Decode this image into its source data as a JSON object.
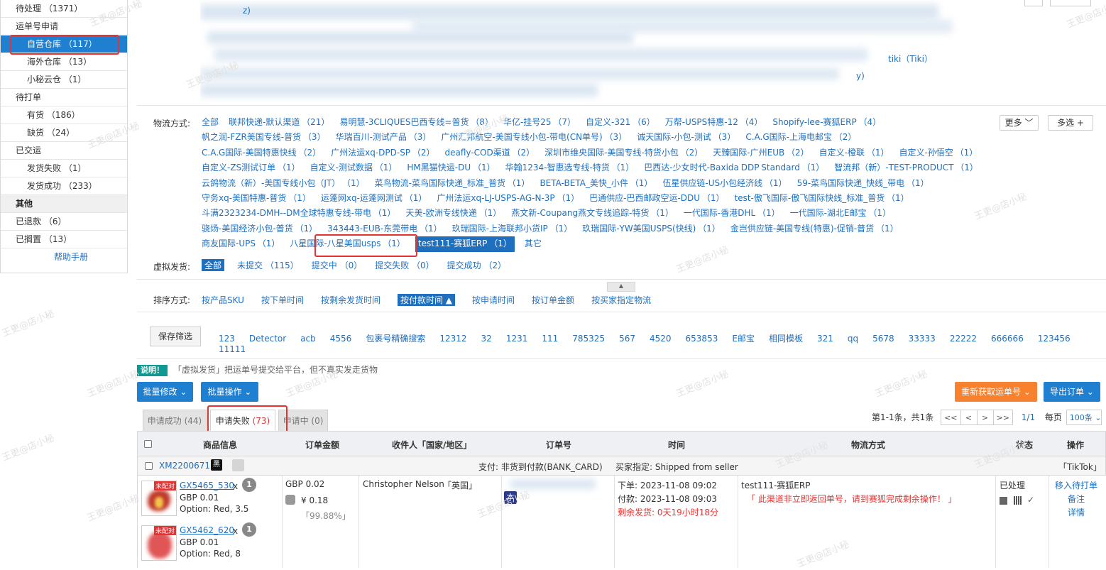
{
  "sidebar": {
    "top_item": "待处理 （1371）",
    "groups": [
      {
        "label": "运单号申请"
      },
      {
        "label": "待打单"
      },
      {
        "label": "已交运"
      }
    ],
    "items": [
      "自营仓库 （117）",
      "海外仓库 （13）",
      "小秘云仓 （1）",
      "有货 （186）",
      "缺货 （24）",
      "发货失败 （1）",
      "发货成功 （233）"
    ],
    "other_title": "其他",
    "other_items": [
      "已退款 （6）",
      "已搁置 （13）"
    ],
    "help": "帮助手册"
  },
  "platform": {
    "tiki": "tiki（Tiki）",
    "partial_y": "y)",
    "partial_z": "z)"
  },
  "filter": {
    "logistics_label": "物流方式:",
    "logistics_options": [
      "全部",
      "联邦快递-默认渠道 （21）",
      "易明慧-3CLIQUES巴西专线=普货 （8）",
      "华亿-挂号25 （7）",
      "自定义-321 （6）",
      "万帮-USPS特惠-12 （4）",
      "Shopify-lee-赛狐ERP （4）",
      "帆之润-FZR美国专线-普货 （3）",
      "华瑞百川-测试产品 （3）",
      "广州汇邦航空-美国专线小包-带电(CN单号) （3）",
      "诚天国际-小包-测试 （3）",
      "C.A.G国际-上海电邮宝 （2）",
      "C.A.G国际-美国特惠快线 （2）",
      "广州法运xq-DPD-SP （2）",
      "deafly-COD渠道 （2）",
      "深圳市维央国际-美国专线-特货小包 （2）",
      "天臻国际-广州EUB （2）",
      "自定义-橙联 （1）",
      "自定义-孙悟空 （1）",
      "自定义-ZS测试订单 （1）",
      "自定义-测试数据 （1）",
      "HM黑猫快运-DU （1）",
      "华翰1234-智惠选专线-特货 （1）",
      "巴西达-少女时代-Baxida DDP Standard （1）",
      "智流邦（新）-TEST-PRODUCT （1）",
      "云鸽物流（新）-美国专线小包（JT） （1）",
      "菜鸟物流-菜鸟国际快递_标准_普货 （1）",
      "BETA-BETA_美快_小件 （1）",
      "伍星供应链-US小包经济线 （1）",
      "59-菜鸟国际快递_快线_带电 （1）",
      "守务xq-美国特惠-普货 （1）",
      "运蓬网xq-运蓬网测试 （1）",
      "广州法运xq-LJ-USPS-AG-N-3P （1）",
      "巴通供应-巴西邮政空运-DDU （1）",
      "test-傲飞国际-傲飞国际快线_标准_普货 （1）",
      "斗满2323234-DMH--DM全球特惠专线-带电 （1）",
      "天美-欧洲专线快递 （1）",
      "燕文新-Coupang燕文专线追踪-特货 （1）",
      "一代国际-香港DHL （1）",
      "一代国际-湖北E邮宝 （1）",
      "骁炀-美国经济小包-普货 （1）",
      "343443-EUB-东莞带电 （1）",
      "玖瑞国际-上海联邦小货IP （1）",
      "玖瑞国际-YW美国USPS(快线) （1）",
      "金岂供应链-美国专线(特惠)-促销-普货 （1）",
      "商友国际-UPS （1）",
      "八星国际-八星美国usps （1）",
      "test111-赛狐ERP （1）",
      "其它"
    ],
    "more_btn": "更多",
    "multi_btn": "多选 +",
    "virtual_label": "虚拟发货:",
    "virtual_options": [
      "全部",
      "未提交 （115）",
      "提交中 （0）",
      "提交失败 （0）",
      "提交成功 （2）"
    ],
    "sort_label": "排序方式:",
    "sort_options": [
      "按产品SKU",
      "按下单时间",
      "按剩余发货时间",
      "按付款时间 ▲",
      "按申请时间",
      "按订单金额",
      "按买家指定物流"
    ],
    "save_btn": "保存筛选",
    "saved_filters": [
      "123",
      "Detector",
      "acb",
      "4556",
      "包裹号精确搜索",
      "12312",
      "32",
      "1231",
      "111",
      "785325",
      "567",
      "4520",
      "653853",
      "E邮宝",
      "相同模板",
      "321",
      "qq",
      "5678",
      "33333",
      "22222",
      "666666",
      "123456",
      "11111"
    ]
  },
  "note": {
    "badge": "说明！",
    "text": "「虚拟发货」把运单号提交给平台，但不真实发走货物"
  },
  "actions": {
    "batch_edit": "批量修改",
    "batch_op": "批量操作",
    "refetch": "重新获取运单号",
    "export": "导出订单"
  },
  "tabs": [
    {
      "label": "申请成功 (44)"
    },
    {
      "label": "申请失败 ",
      "count": "(73)"
    },
    {
      "label": "申请中 (0)"
    }
  ],
  "pager": {
    "summary": "第1-1条，共1条",
    "first": "<<",
    "prev": "<",
    "next": ">",
    "last": ">>",
    "page": "1/1",
    "per_page_label": "每页",
    "per_page_value": "100条"
  },
  "table": {
    "headers": [
      "商品信息",
      "订单金额",
      "收件人「国家/地区」",
      "订单号",
      "时间",
      "物流方式",
      "状态",
      "操作"
    ],
    "group_row": {
      "order_id": "XM2200671",
      "shop_badge": "黑",
      "payment": "支付: 非货到付款(BANK_CARD)",
      "buyer_choice": "买家指定:  Shipped from seller",
      "platform": "「TikTok」"
    },
    "order": {
      "products": [
        {
          "sku": "GX5465_530",
          "x": "x",
          "qty": "1",
          "price": "GBP 0.01",
          "option": "Option:  Red, 3.5",
          "tag": "未配对"
        },
        {
          "sku": "GX5462_620",
          "x": "x",
          "qty": "1",
          "price": "GBP 0.01",
          "option": "Option:  Red, 8",
          "tag": "未配对"
        }
      ],
      "amount": "GBP 0.02",
      "amount_cny": "¥ 0.18",
      "profit_pct": "「99.88%」",
      "recipient": "Christopher Nelson",
      "country": "「英国」",
      "order_badge": "本",
      "order_time": "下单:  2023-11-08 09:02",
      "pay_time": "付款:  2023-11-08 09:03",
      "remaining": "剩余发货:  0天19小时18分",
      "logistics": "test111-赛狐ERP",
      "logistics_msg": "「 此渠道非立即返回单号，请到赛狐完成剩余操作！ 」",
      "status": "已处理",
      "ops": [
        "移入待打单",
        "备注",
        "详情"
      ]
    }
  },
  "watermark": "王更@店小秘"
}
